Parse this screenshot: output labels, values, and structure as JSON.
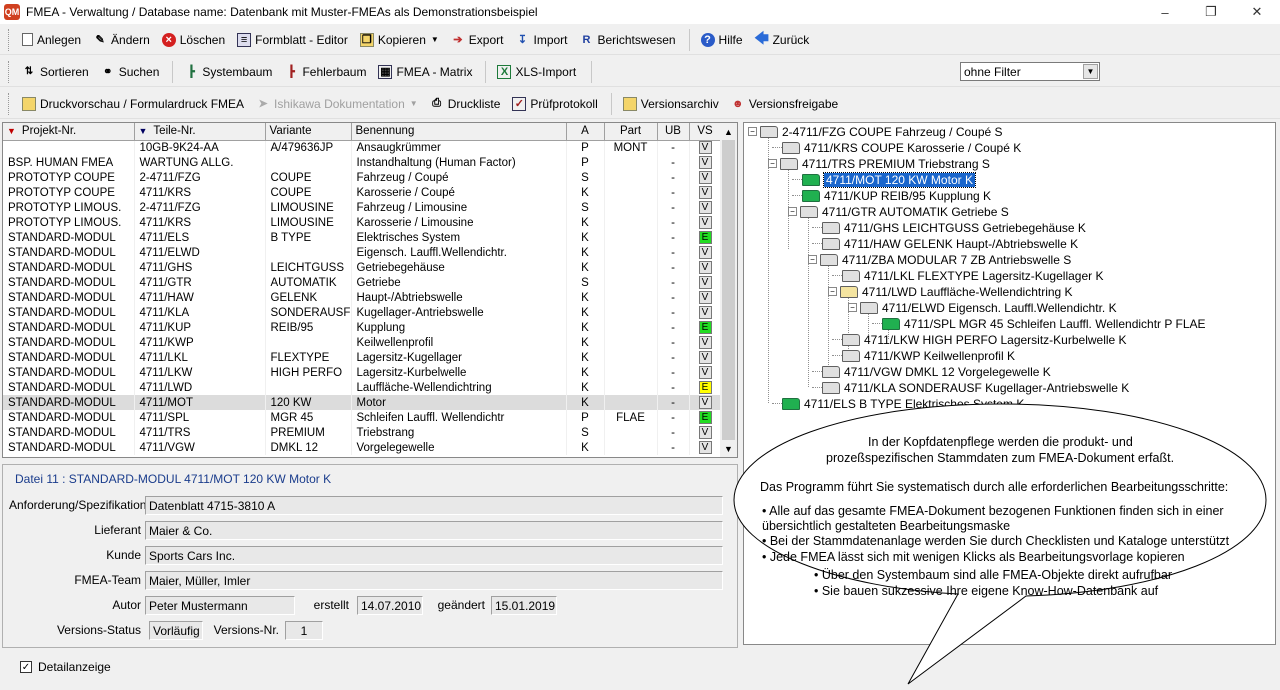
{
  "window": {
    "title": "FMEA - Verwaltung / Database name: Datenbank mit Muster-FMEAs als Demonstrationsbeispiel",
    "app_icon": "QM"
  },
  "toolbar1": [
    "Anlegen",
    "Ändern",
    "Löschen",
    "Formblatt - Editor",
    "Kopieren",
    "Export",
    "Import",
    "Berichtswesen",
    "Hilfe",
    "Zurück"
  ],
  "toolbar2": [
    "Sortieren",
    "Suchen",
    "Systembaum",
    "Fehlerbaum",
    "FMEA - Matrix",
    "XLS-Import"
  ],
  "toolbar3": [
    "Druckvorschau / Formulardruck FMEA",
    "Ishikawa Dokumentation",
    "Druckliste",
    "Prüfprotokoll",
    "Versionsarchiv",
    "Versionsfreigabe"
  ],
  "filter": {
    "value": "ohne Filter"
  },
  "grid": {
    "headers": [
      "Projekt-Nr.",
      "Teile-Nr.",
      "Variante",
      "Benennung",
      "A",
      "Part",
      "UB",
      "VS"
    ],
    "rows": [
      [
        "",
        "10GB-9K24-AA",
        "A/479636JP",
        "Ansaugkrümmer",
        "P",
        "MONT",
        "-",
        "V"
      ],
      [
        "BSP. HUMAN FMEA",
        "WARTUNG ALLG.",
        "",
        "Instandhaltung (Human Factor)",
        "P",
        "",
        "-",
        "V"
      ],
      [
        "PROTOTYP COUPE",
        "2-4711/FZG",
        "COUPE",
        "Fahrzeug / Coupé",
        "S",
        "",
        "-",
        "V"
      ],
      [
        "PROTOTYP COUPE",
        "4711/KRS",
        "COUPE",
        "Karosserie / Coupé",
        "K",
        "",
        "-",
        "V"
      ],
      [
        "PROTOTYP LIMOUS.",
        "2-4711/FZG",
        "LIMOUSINE",
        "Fahrzeug / Limousine",
        "S",
        "",
        "-",
        "V"
      ],
      [
        "PROTOTYP LIMOUS.",
        "4711/KRS",
        "LIMOUSINE",
        "Karosserie / Limousine",
        "K",
        "",
        "-",
        "V"
      ],
      [
        "STANDARD-MODUL",
        "4711/ELS",
        "B TYPE",
        "Elektrisches System",
        "K",
        "",
        "-",
        "E"
      ],
      [
        "STANDARD-MODUL",
        "4711/ELWD",
        "",
        "Eigensch. Lauffl.Wellendichtr.",
        "K",
        "",
        "-",
        "V"
      ],
      [
        "STANDARD-MODUL",
        "4711/GHS",
        "LEICHTGUSS",
        "Getriebegehäuse",
        "K",
        "",
        "-",
        "V"
      ],
      [
        "STANDARD-MODUL",
        "4711/GTR",
        "AUTOMATIK",
        "Getriebe",
        "S",
        "",
        "-",
        "V"
      ],
      [
        "STANDARD-MODUL",
        "4711/HAW",
        "GELENK",
        "Haupt-/Abtriebswelle",
        "K",
        "",
        "-",
        "V"
      ],
      [
        "STANDARD-MODUL",
        "4711/KLA",
        "SONDERAUSF",
        "Kugellager-Antriebswelle",
        "K",
        "",
        "-",
        "V"
      ],
      [
        "STANDARD-MODUL",
        "4711/KUP",
        "REIB/95",
        "Kupplung",
        "K",
        "",
        "-",
        "E"
      ],
      [
        "STANDARD-MODUL",
        "4711/KWP",
        "",
        "Keilwellenprofil",
        "K",
        "",
        "-",
        "V"
      ],
      [
        "STANDARD-MODUL",
        "4711/LKL",
        "FLEXTYPE",
        "Lagersitz-Kugellager",
        "K",
        "",
        "-",
        "V"
      ],
      [
        "STANDARD-MODUL",
        "4711/LKW",
        "HIGH PERFO",
        "Lagersitz-Kurbelwelle",
        "K",
        "",
        "-",
        "V"
      ],
      [
        "STANDARD-MODUL",
        "4711/LWD",
        "",
        "Lauffläche-Wellendichtring",
        "K",
        "",
        "-",
        "E"
      ],
      [
        "STANDARD-MODUL",
        "4711/MOT",
        "120 KW",
        "Motor",
        "K",
        "",
        "-",
        "V"
      ],
      [
        "STANDARD-MODUL",
        "4711/SPL",
        "MGR 45",
        "Schleifen Lauffl. Wellendichtr",
        "P",
        "FLAE",
        "-",
        "E"
      ],
      [
        "STANDARD-MODUL",
        "4711/TRS",
        "PREMIUM",
        "Triebstrang",
        "S",
        "",
        "-",
        "V"
      ],
      [
        "STANDARD-MODUL",
        "4711/VGW",
        "DMKL 12",
        "Vorgelegewelle",
        "K",
        "",
        "-",
        "V"
      ]
    ],
    "vs_colors": [
      "",
      "",
      "",
      "",
      "",
      "",
      "green",
      "",
      "",
      "",
      "",
      "",
      "green",
      "",
      "",
      "",
      "yellow",
      "",
      "green",
      "",
      ""
    ]
  },
  "detail": {
    "header": "Datei 11 : STANDARD-MODUL 4711/MOT 120 KW Motor K",
    "labels": {
      "anf": "Anforderung/Spezifikation",
      "lief": "Lieferant",
      "kunde": "Kunde",
      "team": "FMEA-Team",
      "autor": "Autor",
      "erstellt": "erstellt",
      "geaendert": "geändert",
      "vstatus": "Versions-Status",
      "vnr": "Versions-Nr."
    },
    "values": {
      "anf": "Datenblatt 4715-3810 A",
      "lief": "Maier & Co.",
      "kunde": "Sports Cars Inc.",
      "team": "Maier, Müller, Imler",
      "autor": "Peter Mustermann",
      "erstellt": "14.07.2010",
      "geaendert": "15.01.2019",
      "vstatus": "Vorläufig",
      "vnr": "1"
    },
    "checkbox": "Detailanzeige"
  },
  "tree": [
    "2-4711/FZG  COUPE  Fahrzeug / Coupé  S",
    "4711/KRS  COUPE  Karosserie / Coupé  K",
    "4711/TRS  PREMIUM  Triebstrang  S",
    "4711/MOT  120 KW  Motor  K",
    "4711/KUP  REIB/95  Kupplung  K",
    "4711/GTR  AUTOMATIK  Getriebe  S",
    "4711/GHS  LEICHTGUSS  Getriebegehäuse  K",
    "4711/HAW  GELENK  Haupt-/Abtriebswelle  K",
    "4711/ZBA  MODULAR 7  ZB Antriebswelle  S",
    "4711/LKL  FLEXTYPE  Lagersitz-Kugellager  K",
    "4711/LWD    Lauffläche-Wellendichtring  K",
    "4711/ELWD    Eigensch. Lauffl.Wellendichtr.  K",
    "4711/SPL  MGR 45  Schleifen Lauffl. Wellendichtr  P  FLAE",
    "4711/LKW  HIGH PERFO  Lagersitz-Kurbelwelle  K",
    "4711/KWP    Keilwellenprofil  K",
    "4711/VGW  DMKL 12  Vorgelegewelle  K",
    "4711/KLA  SONDERAUSF  Kugellager-Antriebswelle  K",
    "4711/ELS  B  TYPE  Elektrisches System  K"
  ],
  "bubble": [
    "In der Kopfdatenpflege werden die produkt- und",
    "prozeßspezifischen Stammdaten zum FMEA-Dokument erfaßt.",
    "Das Programm führt Sie systematisch durch alle erforderlichen Bearbeitungsschritte:",
    "•  Alle auf das gesamte FMEA-Dokument bezogenen Funktionen finden sich in einer",
    "    übersichtlich gestalteten Bearbeitungsmaske",
    "•  Bei der Stammdatenanlage werden Sie durch Checklisten und Kataloge unterstützt",
    "•  Jede FMEA lässt sich mit wenigen Klicks als Bearbeitungsvorlage kopieren",
    "•  Über den Systembaum sind alle FMEA-Objekte direkt aufrufbar",
    "•  Sie bauen sukzessive Ihre eigene Know-How-Datenbank auf"
  ],
  "colors": {
    "selection": "#1a66cc",
    "detail_header": "#1a3c8c",
    "vs_green": "#22dd22",
    "vs_yellow": "#ffff00",
    "folder_green": "#20b050"
  }
}
